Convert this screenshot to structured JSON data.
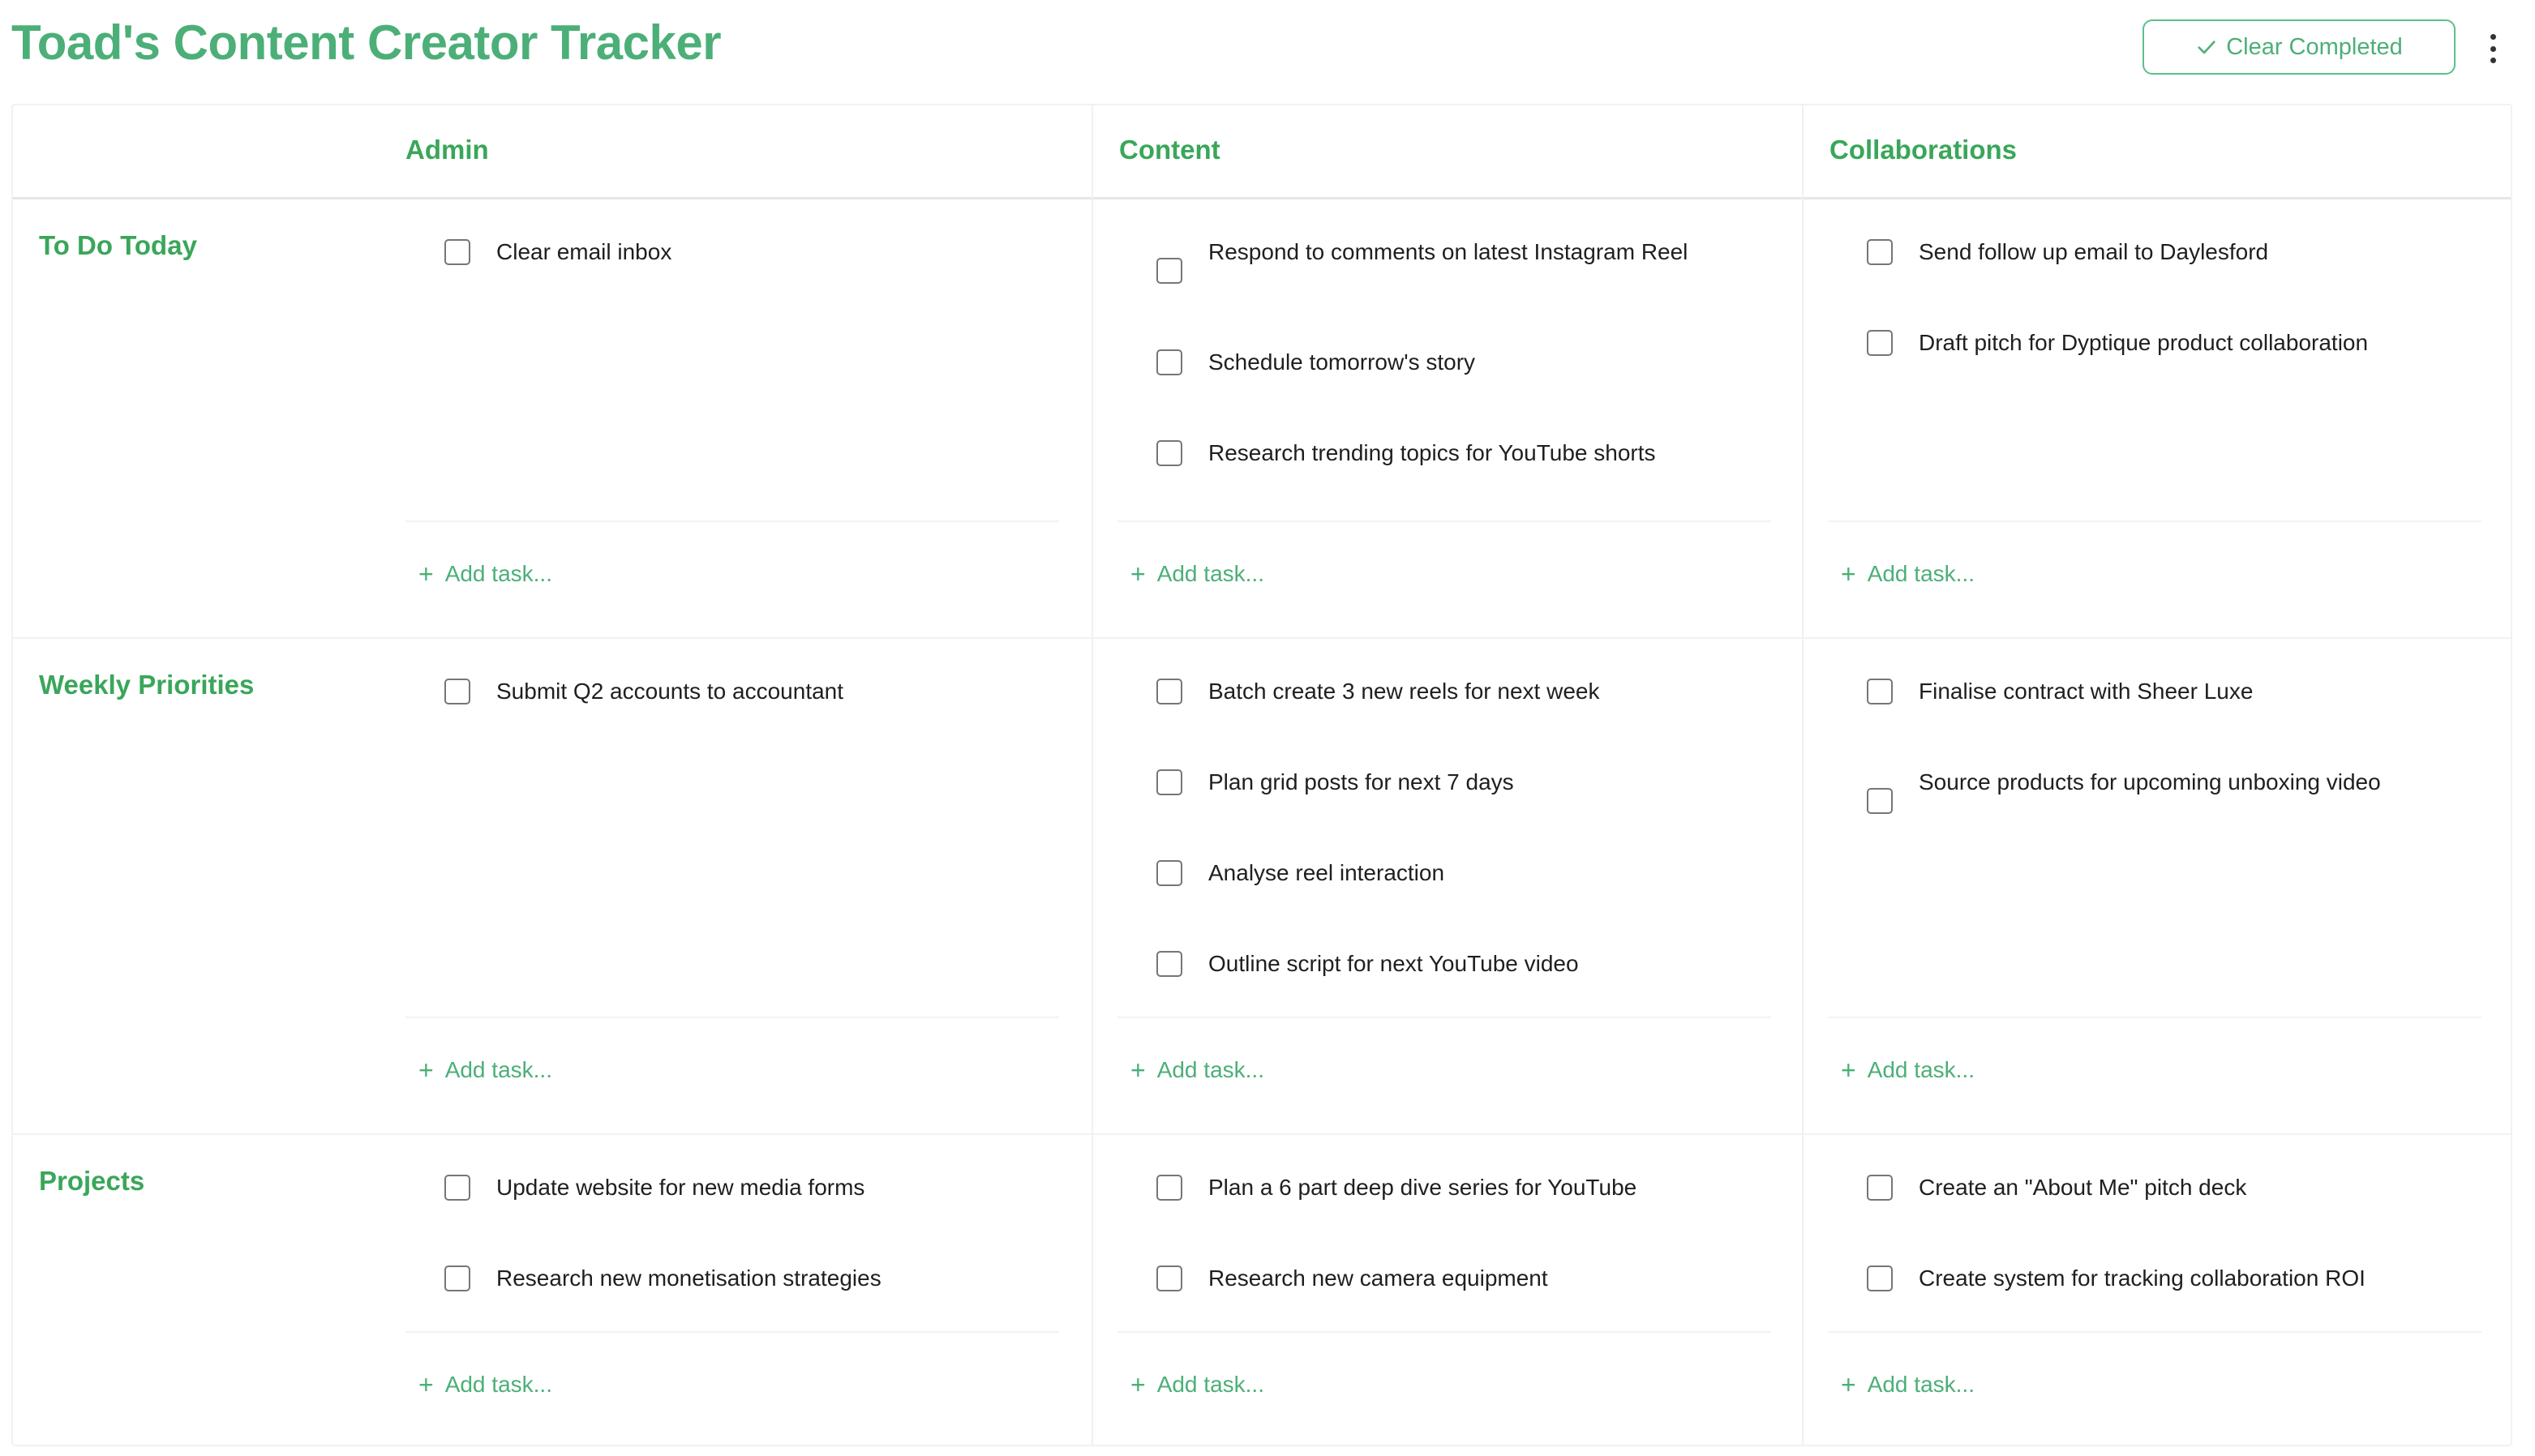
{
  "header": {
    "title": "Toad's Content Creator Tracker",
    "clear_completed_label": "Clear Completed",
    "accent_color": "#4caf78"
  },
  "board": {
    "columns": [
      {
        "label": "Admin"
      },
      {
        "label": "Content"
      },
      {
        "label": "Collaborations"
      }
    ],
    "rows": [
      {
        "label": "To Do Today"
      },
      {
        "label": "Weekly Priorities"
      },
      {
        "label": "Projects"
      }
    ],
    "cells": {
      "r0c0": [
        "Clear email inbox"
      ],
      "r0c1": [
        "Respond to comments on latest Instagram Reel",
        "Schedule tomorrow's story",
        "Research trending topics for YouTube shorts"
      ],
      "r0c2": [
        "Send follow up email to Daylesford",
        "Draft pitch for Dyptique product collaboration"
      ],
      "r1c0": [
        "Submit Q2 accounts to accountant"
      ],
      "r1c1": [
        "Batch create 3 new reels for next week",
        "Plan grid posts for next 7 days",
        "Analyse reel interaction",
        "Outline script for next YouTube video"
      ],
      "r1c2": [
        "Finalise contract with Sheer Luxe",
        "Source products for upcoming unboxing video"
      ],
      "r2c0": [
        "Update website for new media forms",
        "Research new monetisation strategies"
      ],
      "r2c1": [
        "Plan a 6 part deep dive series for YouTube",
        "Research new camera equipment"
      ],
      "r2c2": [
        "Create an \"About Me\" pitch deck",
        "Create system for tracking collaboration ROI"
      ]
    },
    "add_task_label": "Add task..."
  }
}
